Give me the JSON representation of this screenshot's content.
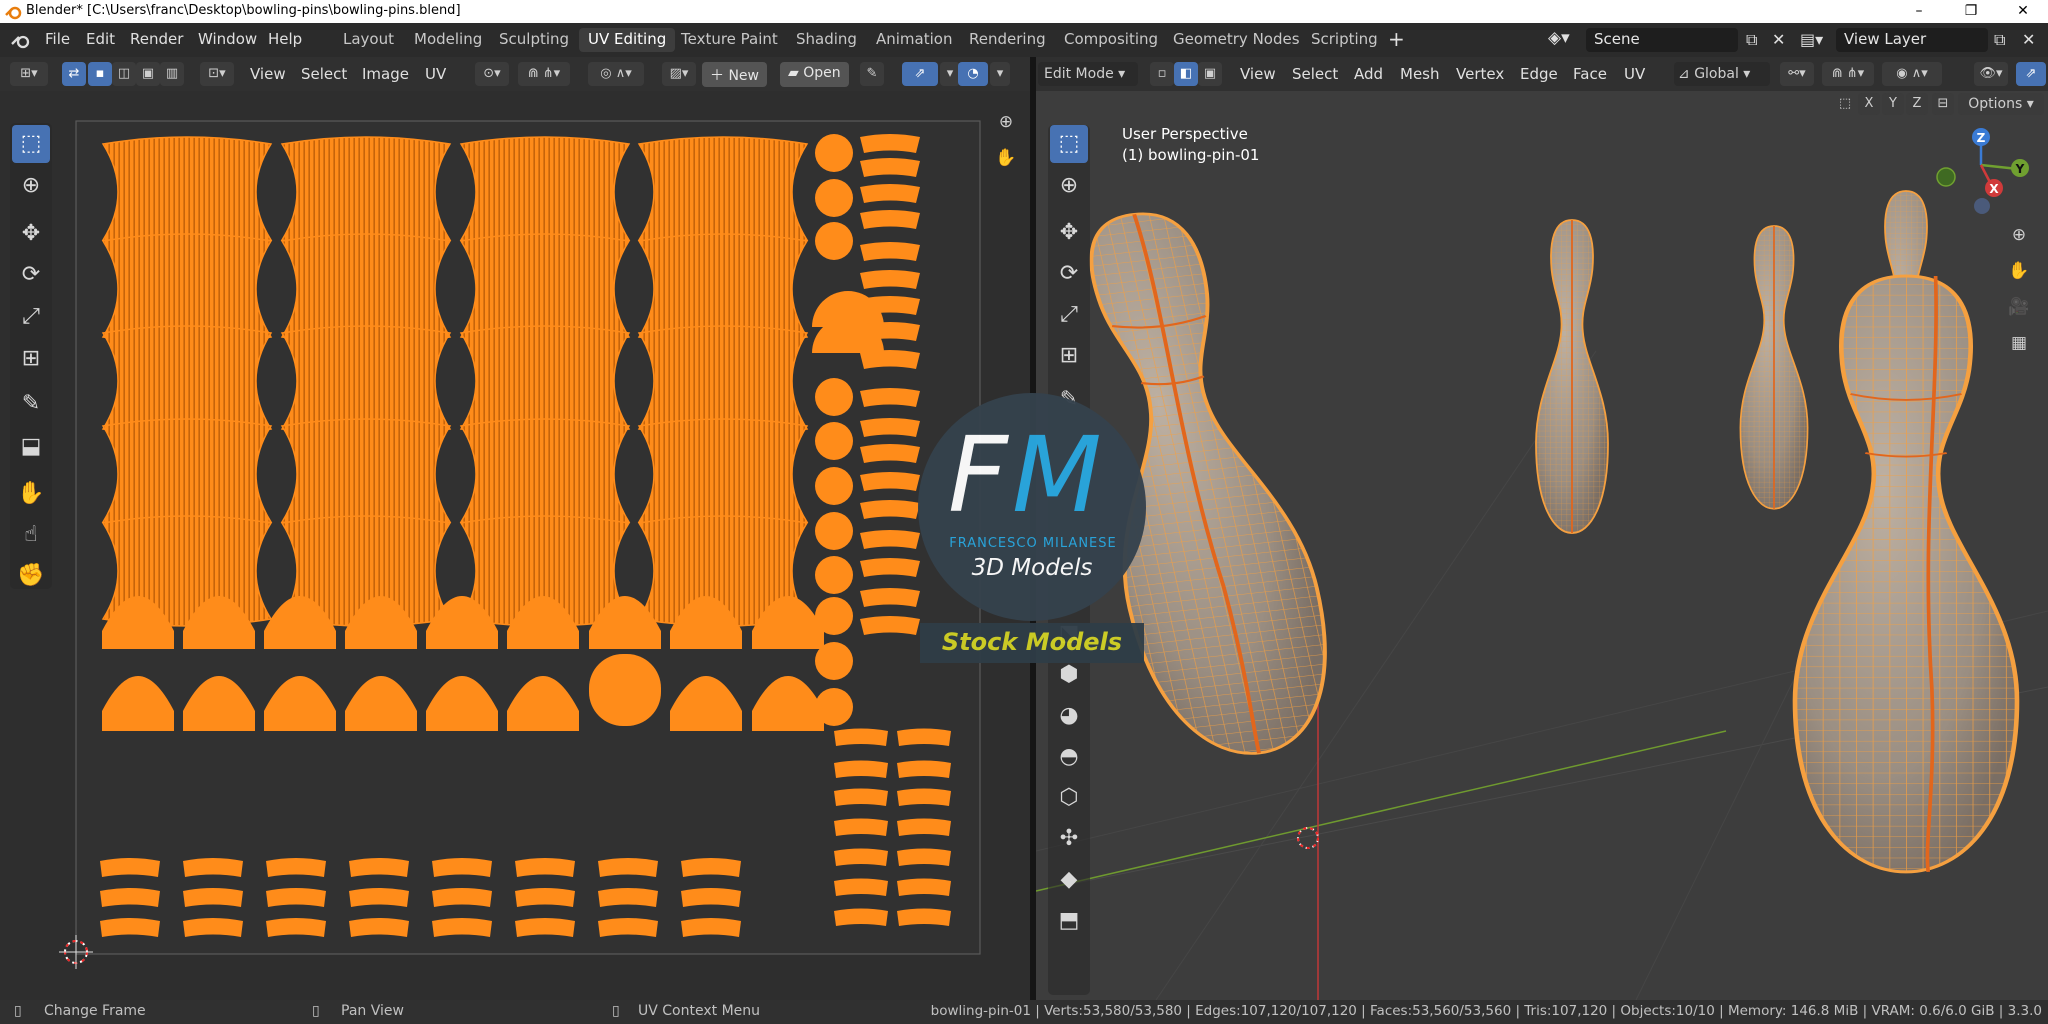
{
  "window": {
    "title": "Blender* [C:\\Users\\franc\\Desktop\\bowling-pins\\bowling-pins.blend]",
    "minimize": "–",
    "restore": "❐",
    "close": "✕"
  },
  "menu": {
    "items": [
      "File",
      "Edit",
      "Render",
      "Window",
      "Help"
    ]
  },
  "workspaces": {
    "tabs": [
      "Layout",
      "Modeling",
      "Sculpting",
      "UV Editing",
      "Texture Paint",
      "Shading",
      "Animation",
      "Rendering",
      "Compositing",
      "Geometry Nodes",
      "Scripting"
    ],
    "active": "UV Editing",
    "add": "+"
  },
  "scene": {
    "label": "Scene",
    "view_layer": "View Layer"
  },
  "uv_editor": {
    "menus": [
      "View",
      "Select",
      "Image",
      "UV"
    ],
    "new_label": "New",
    "open_label": "Open",
    "grid_color": "#ff8c1a",
    "tools": [
      "select-box",
      "cursor",
      "move",
      "rotate",
      "scale",
      "transform",
      "annotate",
      "rip",
      "grab",
      "relax",
      "pinch"
    ]
  },
  "viewport": {
    "mode": "Edit Mode",
    "menus": [
      "View",
      "Select",
      "Add",
      "Mesh",
      "Vertex",
      "Edge",
      "Face",
      "UV"
    ],
    "orientation": "Global",
    "axes": [
      "X",
      "Y",
      "Z"
    ],
    "options_label": "Options",
    "overlay_title": "User Perspective",
    "overlay_object": "(1) bowling-pin-01",
    "gizmo": {
      "z": "Z",
      "y": "Y",
      "x": "X"
    },
    "wire_color": "#f5a040"
  },
  "logo": {
    "monogram_f": "F",
    "monogram_m": "M",
    "name": "FRANCESCO MILANESE",
    "subtitle": "3D Models",
    "banner": "Stock Models"
  },
  "status": {
    "left1": "Change Frame",
    "left2": "Pan View",
    "left3": "UV Context Menu",
    "stats": "bowling-pin-01 | Verts:53,580/53,580 | Edges:107,120/107,120 | Faces:53,560/53,560 | Tris:107,120 | Objects:10/10 | Memory: 146.8 MiB | VRAM: 0.6/6.0 GiB | 3.3.0"
  }
}
